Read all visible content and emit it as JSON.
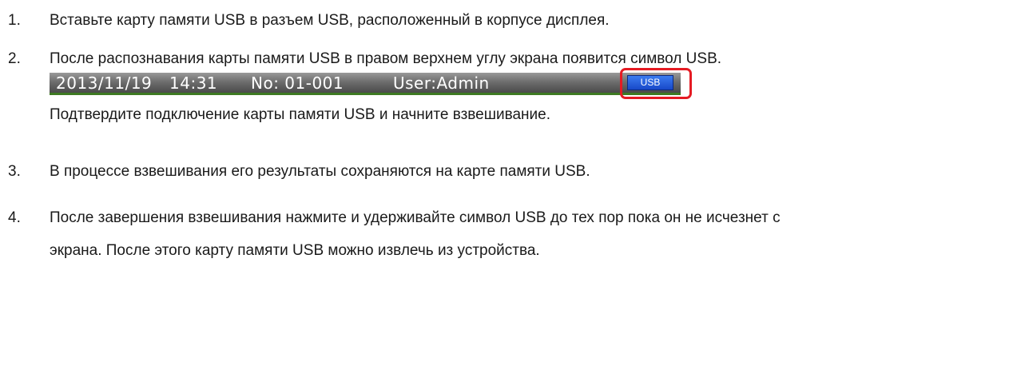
{
  "steps": [
    {
      "number": "1.",
      "lines": [
        "Вставьте карту памяти USB в разъем USB, расположенный в корпусе дисплея."
      ]
    },
    {
      "number": "2.",
      "lines": [
        "После распознавания карты памяти USB в правом верхнем углу экрана появится символ USB."
      ]
    },
    {
      "number": "3.",
      "lines": [
        "В процессе взвешивания его результаты сохраняются на карте памяти USB."
      ]
    },
    {
      "number": "4.",
      "lines": [
        "После завершения взвешивания нажмите и удерживайте символ USB до тех пор пока он не исчезнет с",
        "экрана. После этого карту памяти USB можно извлечь из устройства."
      ]
    }
  ],
  "status_bar": {
    "date": "2013/11/19",
    "time": "14:31",
    "number": "No: 01-001",
    "user": "User:Admin",
    "usb_label": "USB"
  },
  "step2_note": "Подтвердите подключение карты памяти USB и начните взвешивание.",
  "colors": {
    "highlight": "#e51b23",
    "usb_badge": "#2a5fdc",
    "status_bar_accent": "#3e7a22"
  }
}
